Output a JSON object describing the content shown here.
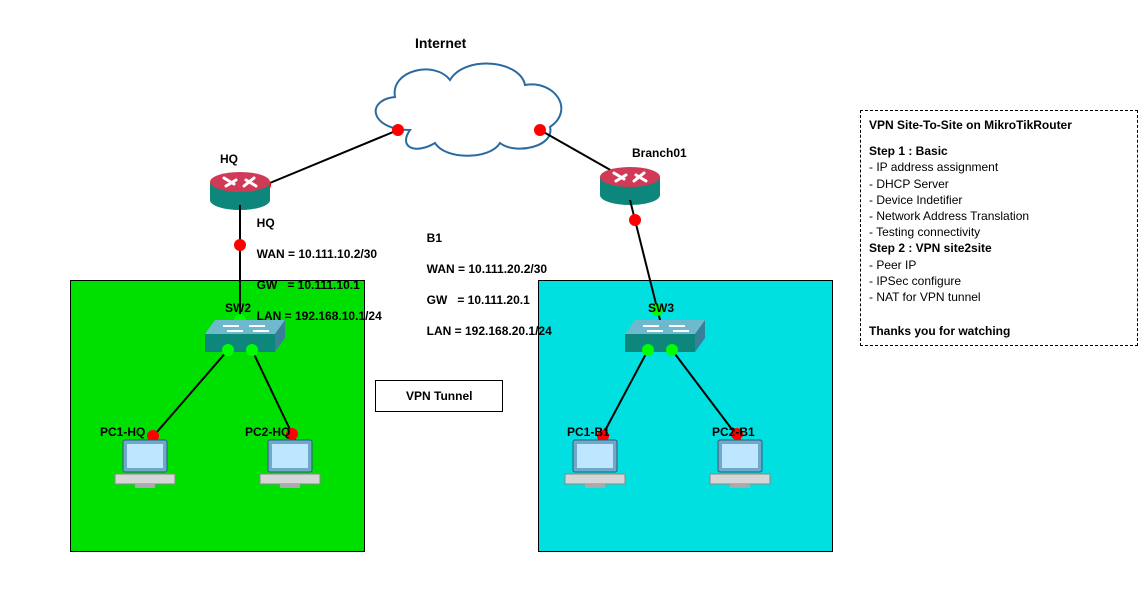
{
  "title": "Internet",
  "sites": {
    "hq": {
      "routerLabel": "HQ",
      "cfgLabel": "HQ",
      "wan": "WAN = 10.111.10.2/30",
      "gw": "GW   = 10.111.10.1",
      "lan": "LAN = 192.168.10.1/24",
      "switch": "SW2",
      "pc1": "PC1-HQ",
      "pc2": "PC2-HQ"
    },
    "b1": {
      "routerLabel": "Branch01",
      "cfgLabel": "B1",
      "wan": "WAN = 10.111.20.2/30",
      "gw": "GW   = 10.111.20.1",
      "lan": "LAN = 192.168.20.1/24",
      "switch": "SW3",
      "pc1": "PC1-B1",
      "pc2": "PC2-B1"
    }
  },
  "tunnelLabel": "VPN Tunnel",
  "notes": {
    "title": "VPN Site-To-Site on MikroTikRouter",
    "step1": "Step 1 : Basic",
    "s1a": "- IP address assignment",
    "s1b": "- DHCP Server",
    "s1c": "- Device Indetifier",
    "s1d": "- Network Address Translation",
    "s1e": "- Testing connectivity",
    "step2": "Step 2 : VPN site2site",
    "s2a": "- Peer IP",
    "s2b": "- IPSec configure",
    "s2c": "- NAT for VPN tunnel",
    "thanks": "Thanks you for watching"
  },
  "colors": {
    "green": "#00e000",
    "cyan": "#00e0e0",
    "red": "#ff0000",
    "lime": "#00ff00"
  }
}
